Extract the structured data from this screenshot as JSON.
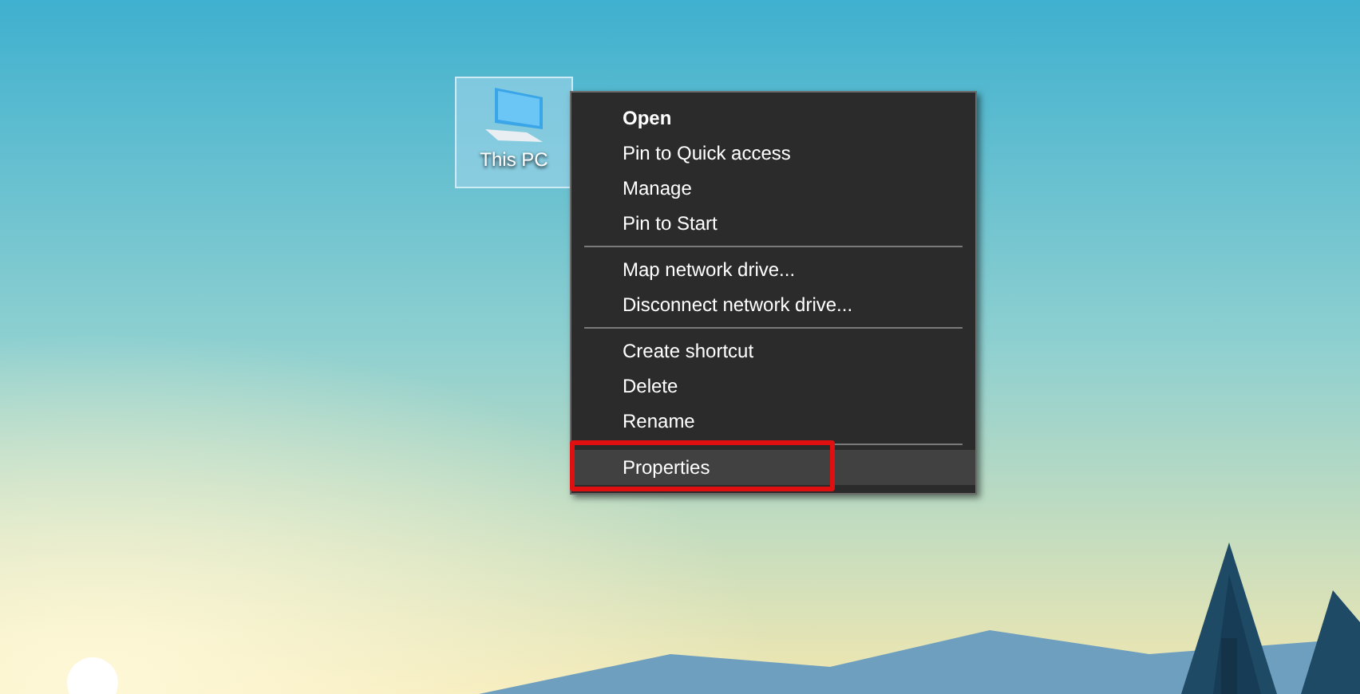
{
  "desktop_icon": {
    "label": "This PC",
    "selected": true
  },
  "context_menu": {
    "groups": [
      [
        {
          "label": "Open",
          "default": true,
          "selected": false,
          "annotated": false
        },
        {
          "label": "Pin to Quick access",
          "default": false,
          "selected": false,
          "annotated": false
        },
        {
          "label": "Manage",
          "default": false,
          "selected": false,
          "annotated": false
        },
        {
          "label": "Pin to Start",
          "default": false,
          "selected": false,
          "annotated": false
        }
      ],
      [
        {
          "label": "Map network drive...",
          "default": false,
          "selected": false,
          "annotated": false
        },
        {
          "label": "Disconnect network drive...",
          "default": false,
          "selected": false,
          "annotated": false
        }
      ],
      [
        {
          "label": "Create shortcut",
          "default": false,
          "selected": false,
          "annotated": false
        },
        {
          "label": "Delete",
          "default": false,
          "selected": false,
          "annotated": false
        },
        {
          "label": "Rename",
          "default": false,
          "selected": false,
          "annotated": false
        }
      ],
      [
        {
          "label": "Properties",
          "default": false,
          "selected": true,
          "annotated": true
        }
      ]
    ]
  }
}
